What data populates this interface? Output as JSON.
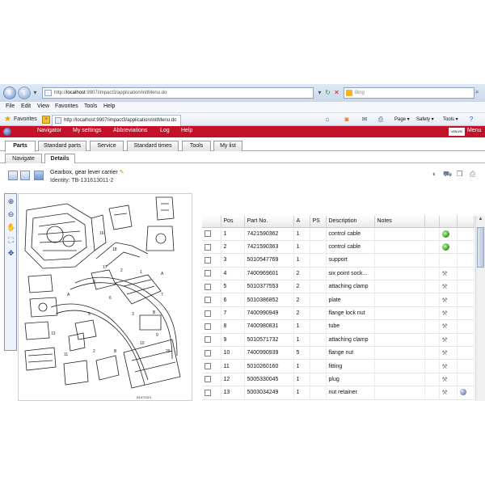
{
  "browser": {
    "address": "http://localhost:9907/impact3/application/initMenu.do",
    "address_prefix": "http://",
    "address_host": "localhost",
    "address_path": ":9907/impact3/application/initMenu.do",
    "search_placeholder": "Bing",
    "menu": [
      "File",
      "Edit",
      "View",
      "Favorites",
      "Tools",
      "Help"
    ],
    "favorites_label": "Favorites",
    "tab_title": "http://localhost:9907/impact3/application/initMenu.do",
    "commands": {
      "page": "Page ▾",
      "safety": "Safety ▾",
      "tools": "Tools ▾"
    }
  },
  "app": {
    "nav": [
      "Navigator",
      "My settings",
      "Abbreviations",
      "Log",
      "Help"
    ],
    "brand": "VOLVO",
    "menu_label": "Menu",
    "tabs": [
      "Parts",
      "Standard parts",
      "Service",
      "Standard times",
      "Tools",
      "My list"
    ],
    "active_tab": "Parts",
    "subtabs": [
      "Navigate",
      "Details"
    ],
    "active_subtab": "Details"
  },
  "group": {
    "title": "Gearbox, gear lever carrier",
    "identity": "Identity: TB-131613011-2",
    "drawing_ref": "B1979321"
  },
  "table": {
    "headers": [
      "",
      "Pos",
      "Part No.",
      "A",
      "PS",
      "Description",
      "Notes",
      "",
      "",
      ""
    ],
    "rows": [
      {
        "pos": "1",
        "part": "7421590362",
        "a": "1",
        "desc": "control cable",
        "icon": "go"
      },
      {
        "pos": "2",
        "part": "7421590363",
        "a": "1",
        "desc": "control cable",
        "icon": "go"
      },
      {
        "pos": "3",
        "part": "5010547769",
        "a": "1",
        "desc": "support",
        "icon": ""
      },
      {
        "pos": "4",
        "part": "7400969601",
        "a": "2",
        "desc": "six point sock...",
        "icon": "tool"
      },
      {
        "pos": "5",
        "part": "5010377553",
        "a": "2",
        "desc": "attaching clamp",
        "icon": "tool"
      },
      {
        "pos": "6",
        "part": "5010386852",
        "a": "2",
        "desc": "plate",
        "icon": "tool"
      },
      {
        "pos": "7",
        "part": "7400990949",
        "a": "2",
        "desc": "flange lock nut",
        "icon": "tool"
      },
      {
        "pos": "8",
        "part": "7400980831",
        "a": "1",
        "desc": "tube",
        "icon": "tool"
      },
      {
        "pos": "9",
        "part": "5010571732",
        "a": "1",
        "desc": "attaching clamp",
        "icon": "tool"
      },
      {
        "pos": "10",
        "part": "7400990939",
        "a": "5",
        "desc": "flange nut",
        "icon": "tool"
      },
      {
        "pos": "11",
        "part": "5010260160",
        "a": "1",
        "desc": "fitting",
        "icon": "tool"
      },
      {
        "pos": "12",
        "part": "5005330045",
        "a": "1",
        "desc": "plug",
        "icon": "tool"
      },
      {
        "pos": "13",
        "part": "5003034249",
        "a": "1",
        "desc": "nut retainer",
        "icon": "tool",
        "extra": "info"
      }
    ]
  }
}
